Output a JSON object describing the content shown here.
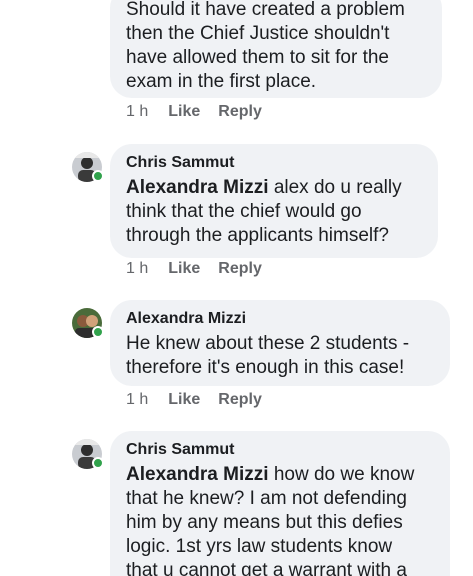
{
  "comments": [
    {
      "author": "",
      "text": "Should it have created a problem\nthen the Chief Justice shouldn't\nhave allowed them to sit for the\nexam in the first place.",
      "time": "1 h",
      "like": "Like",
      "reply": "Reply"
    },
    {
      "author": "Chris Sammut",
      "mention": "Alexandra Mizzi",
      "text": " alex do u really\nthink that the chief would go\nthrough the applicants himself?",
      "time": "1 h",
      "like": "Like",
      "reply": "Reply"
    },
    {
      "author": "Alexandra Mizzi",
      "text": "He knew about these 2 students -\ntherefore it's enough in this case!",
      "time": "1 h",
      "like": "Like",
      "reply": "Reply"
    },
    {
      "author": "Chris Sammut",
      "mention": "Alexandra Mizzi",
      "text": " how do we know\nthat he knew? I am not defending\nhim by any means but this defies\nlogic. 1st yrs law students know\nthat u cannot get a warrant with a"
    }
  ],
  "colors": {
    "bubble": "#f0f2f5",
    "text": "#1c1e21",
    "meta": "#65676b",
    "online": "#31a24c"
  },
  "icons": [
    "avatar-chris-sammut",
    "avatar-alexandra-mizzi",
    "online-status-icon"
  ]
}
